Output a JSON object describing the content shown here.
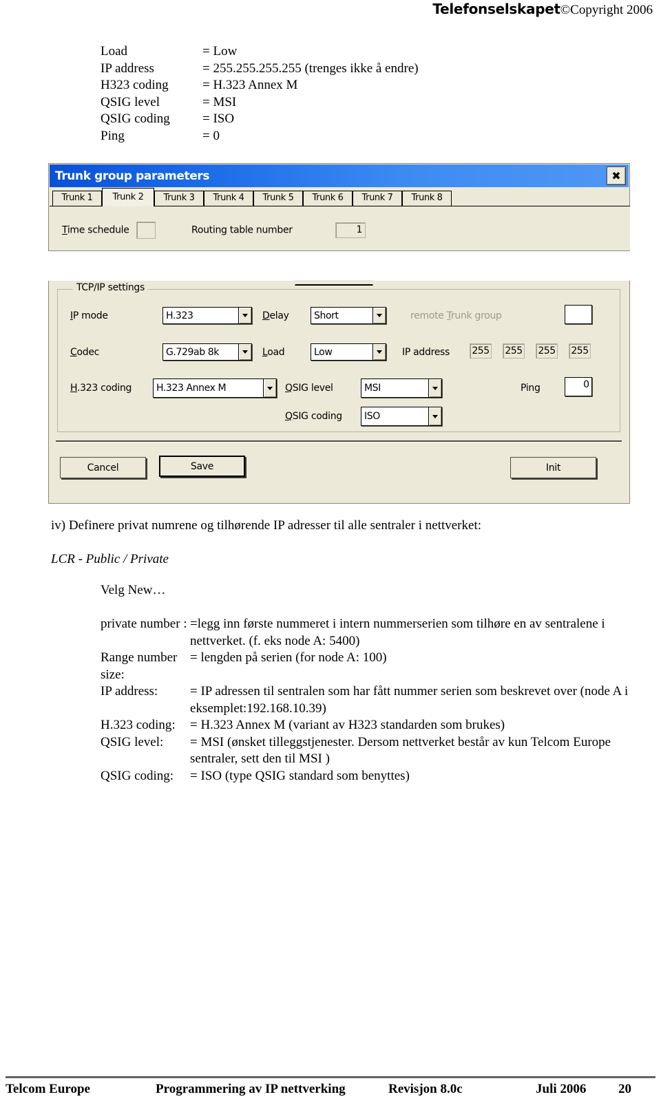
{
  "header": {
    "brand": "Telefonselskapet",
    "copyright": "©Copyright 2006"
  },
  "param_list": [
    {
      "key": "Load",
      "value": "= Low"
    },
    {
      "key": "IP address",
      "value": "= 255.255.255.255 (trenges ikke å endre)"
    },
    {
      "key": "H323 coding",
      "value": "= H.323 Annex M"
    },
    {
      "key": "QSIG level",
      "value": "= MSI"
    },
    {
      "key": "QSIG coding",
      "value": "= ISO"
    },
    {
      "key": "Ping",
      "value": "= 0"
    }
  ],
  "dialog": {
    "title": "Trunk group parameters",
    "close_label": "✖",
    "tabs": [
      {
        "label": "Trunk 1",
        "active": false
      },
      {
        "label": "Trunk 2",
        "active": true
      },
      {
        "label": "Trunk 3",
        "active": false
      },
      {
        "label": "Trunk 4",
        "active": false
      },
      {
        "label": "Trunk 5",
        "active": false
      },
      {
        "label": "Trunk 6",
        "active": false
      },
      {
        "label": "Trunk 7",
        "active": false
      },
      {
        "label": "Trunk 8",
        "active": false
      }
    ],
    "tab_page": {
      "time_schedule_label": "Time schedule",
      "time_schedule_value": "",
      "routing_table_label": "Routing table number",
      "routing_table_value": "1"
    },
    "tcpip": {
      "group_title": "TCP/IP settings",
      "ip_mode_label": "IP mode",
      "ip_mode_value": "H.323",
      "codec_label": "Codec",
      "codec_value": "G.729ab 8k",
      "h323_coding_label": "H.323 coding",
      "h323_coding_value": "H.323 Annex M",
      "delay_label": "Delay",
      "delay_value": "Short",
      "load_label": "Load",
      "load_value": "Low",
      "qsig_level_label": "QSIG level",
      "qsig_level_value": "MSI",
      "qsig_coding_label": "QSIG coding",
      "qsig_coding_value": "ISO",
      "remote_trunk_group_label": "remote Trunk group",
      "remote_trunk_group_value": "",
      "ip_address_label": "IP address",
      "ip_octets": [
        "255",
        "255",
        "255",
        "255"
      ],
      "ping_label": "Ping",
      "ping_value": "0"
    },
    "buttons": {
      "cancel": "Cancel",
      "save": "Save",
      "init": "Init"
    }
  },
  "body": {
    "step_iv": "iv) Definere privat numrene og tilhørende IP adresser til alle sentraler i nettverket:",
    "lcr_line": "LCR  - Public / Private",
    "velg_new": "Velg  New…",
    "definitions": [
      {
        "term": "private number :",
        "desc": "=legg inn første nummeret i intern nummerserien som tilhøre en av sentralene i nettverket. (f. eks node A: 5400)"
      },
      {
        "term": "Range number size:",
        "desc": "= lengden på serien (for node A: 100)"
      },
      {
        "term": "IP address:",
        "desc": "= IP adressen til sentralen som har fått nummer serien som beskrevet over (node A i eksemplet:192.168.10.39)"
      },
      {
        "term": "H.323 coding:",
        "desc": "= H.323 Annex M (variant av H323 standarden som brukes)"
      },
      {
        "term": "QSIG level:",
        "desc": "= MSI (ønsket tilleggstjenester.  Dersom nettverket består av kun Telcom Europe sentraler, sett den til MSI )"
      },
      {
        "term": "QSIG coding:",
        "desc": "= ISO (type QSIG standard som benyttes)"
      }
    ]
  },
  "footer": {
    "company": "Telcom Europe",
    "document": "Programmering av IP nettverking",
    "revision": "Revisjon 8.0c",
    "date": "Juli 2006",
    "page": "20"
  }
}
